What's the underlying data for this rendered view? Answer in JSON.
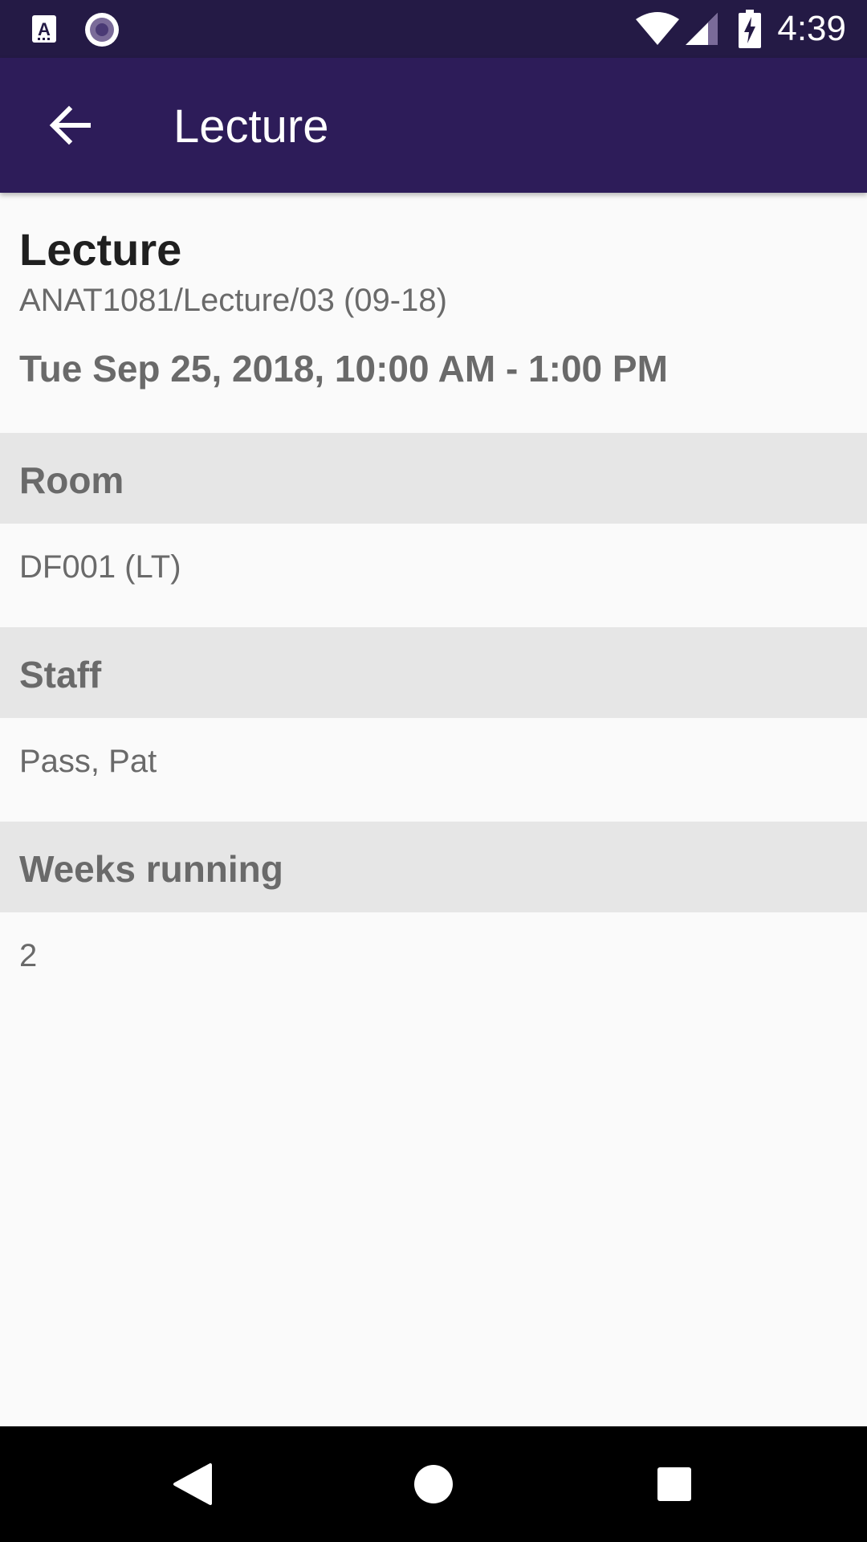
{
  "status_bar": {
    "time": "4:39",
    "icons": [
      "text-a-notification-icon",
      "circle-notification-icon",
      "wifi-icon",
      "cell-signal-icon",
      "battery-charging-icon"
    ]
  },
  "app_bar": {
    "title": "Lecture",
    "back_icon": "arrow-back-icon"
  },
  "event": {
    "title": "Lecture",
    "code": "ANAT1081/Lecture/03 (09-18)",
    "datetime": "Tue Sep 25, 2018, 10:00 AM - 1:00 PM"
  },
  "sections": [
    {
      "heading": "Room",
      "value": "DF001 (LT)"
    },
    {
      "heading": "Staff",
      "value": "Pass, Pat"
    },
    {
      "heading": "Weeks running",
      "value": "2"
    }
  ],
  "nav_bar": {
    "icons": [
      "nav-back-icon",
      "nav-home-icon",
      "nav-recents-icon"
    ]
  },
  "colors": {
    "status_bar": "#241a45",
    "app_bar": "#2d1c59",
    "section_header_bg": "#e6e6e6",
    "background": "#fafafa"
  }
}
